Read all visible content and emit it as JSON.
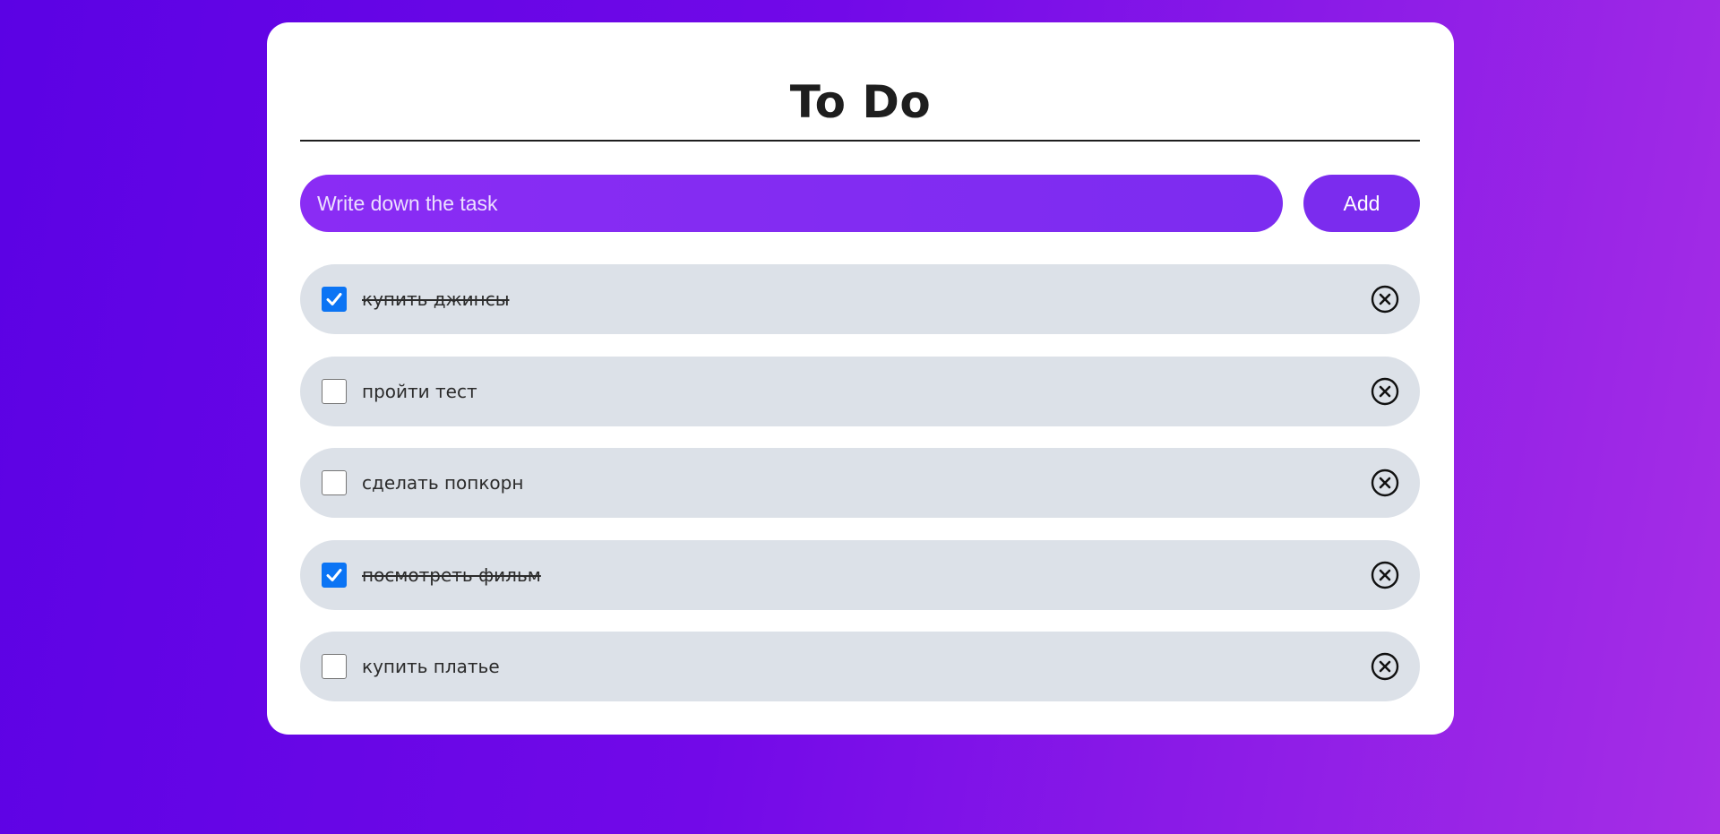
{
  "app": {
    "title": "To Do"
  },
  "input": {
    "placeholder": "Write down the task",
    "value": ""
  },
  "add_button": {
    "label": "Add"
  },
  "colors": {
    "background_start": "#5b02e4",
    "background_end": "#a62ee6",
    "card": "#ffffff",
    "input_fill": "#8a2cf4",
    "button_fill": "#7b2cee",
    "task_fill": "#dce1e8",
    "checkbox_checked": "#0b74f4"
  },
  "tasks": [
    {
      "label": "купить джинсы",
      "done": true,
      "icon": "close-circle-icon"
    },
    {
      "label": "пройти тест",
      "done": false,
      "icon": "close-circle-icon"
    },
    {
      "label": "сделать попкорн",
      "done": false,
      "icon": "close-circle-icon"
    },
    {
      "label": "посмотреть фильм",
      "done": true,
      "icon": "close-circle-icon"
    },
    {
      "label": "купить платье",
      "done": false,
      "icon": "close-circle-icon"
    }
  ]
}
